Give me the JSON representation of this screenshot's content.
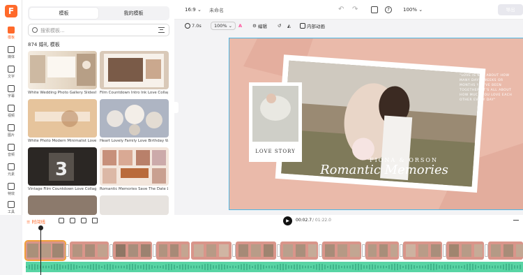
{
  "sidebar": {
    "items": [
      {
        "label": "模板",
        "icon": "template-icon",
        "active": true
      },
      {
        "label": "媒体",
        "icon": "media-icon"
      },
      {
        "label": "文字",
        "icon": "text-icon"
      },
      {
        "label": "字幕",
        "icon": "subtitle-icon"
      },
      {
        "label": "视频",
        "icon": "video-icon"
      },
      {
        "label": "图片",
        "icon": "image-icon"
      },
      {
        "label": "音频",
        "icon": "audio-icon"
      },
      {
        "label": "元素",
        "icon": "element-icon"
      },
      {
        "label": "特效",
        "icon": "effect-icon"
      },
      {
        "label": "工具",
        "icon": "tool-icon"
      }
    ]
  },
  "templates_panel": {
    "tabs": [
      "模板",
      "我的模板"
    ],
    "search_placeholder": "搜索模板...",
    "count_label": "874 婚礼 模板",
    "items": [
      {
        "title": "White Wedding Photo Gallery Slidesh..."
      },
      {
        "title": "Film Countdown Intro Ink Love Collag..."
      },
      {
        "title": "White Photo Modern Minimalist Love ..."
      },
      {
        "title": "Heart Lovely Family Love Birthday W..."
      },
      {
        "title": "Vintage Film Countdown Love Collag..."
      },
      {
        "title": "Romantic Memories Save The Date L..."
      }
    ]
  },
  "topbar": {
    "aspect": "16:9",
    "project_name": "未命名",
    "zoom": "100%",
    "export_label": "导出"
  },
  "toolbar": {
    "duration": "7.0s",
    "scale": "100%",
    "edit_label": "编辑",
    "anim_label": "内部动画"
  },
  "canvas": {
    "love_story": "LOVE STORY",
    "names": "FIONA & ORSON",
    "script_title": "Romantic Memories",
    "quote": "\"LOVE IS NOT ABOUT HOW MANY DAYS, WEEKS OR MONTHS YOU'VE BEEN TOGETHER, IT'S ALL ABOUT HOW MUCH YOU LOVE EACH OTHER EVERY DAY\""
  },
  "timeline": {
    "label": "时间线",
    "current_time": "00:02.7",
    "total_time": "/ 01:22.0"
  },
  "colors": {
    "accent": "#ff6a2b",
    "canvas_bg": "#e9b6a6",
    "audio_track": "#58d4a4",
    "selection": "#f2a03a"
  }
}
